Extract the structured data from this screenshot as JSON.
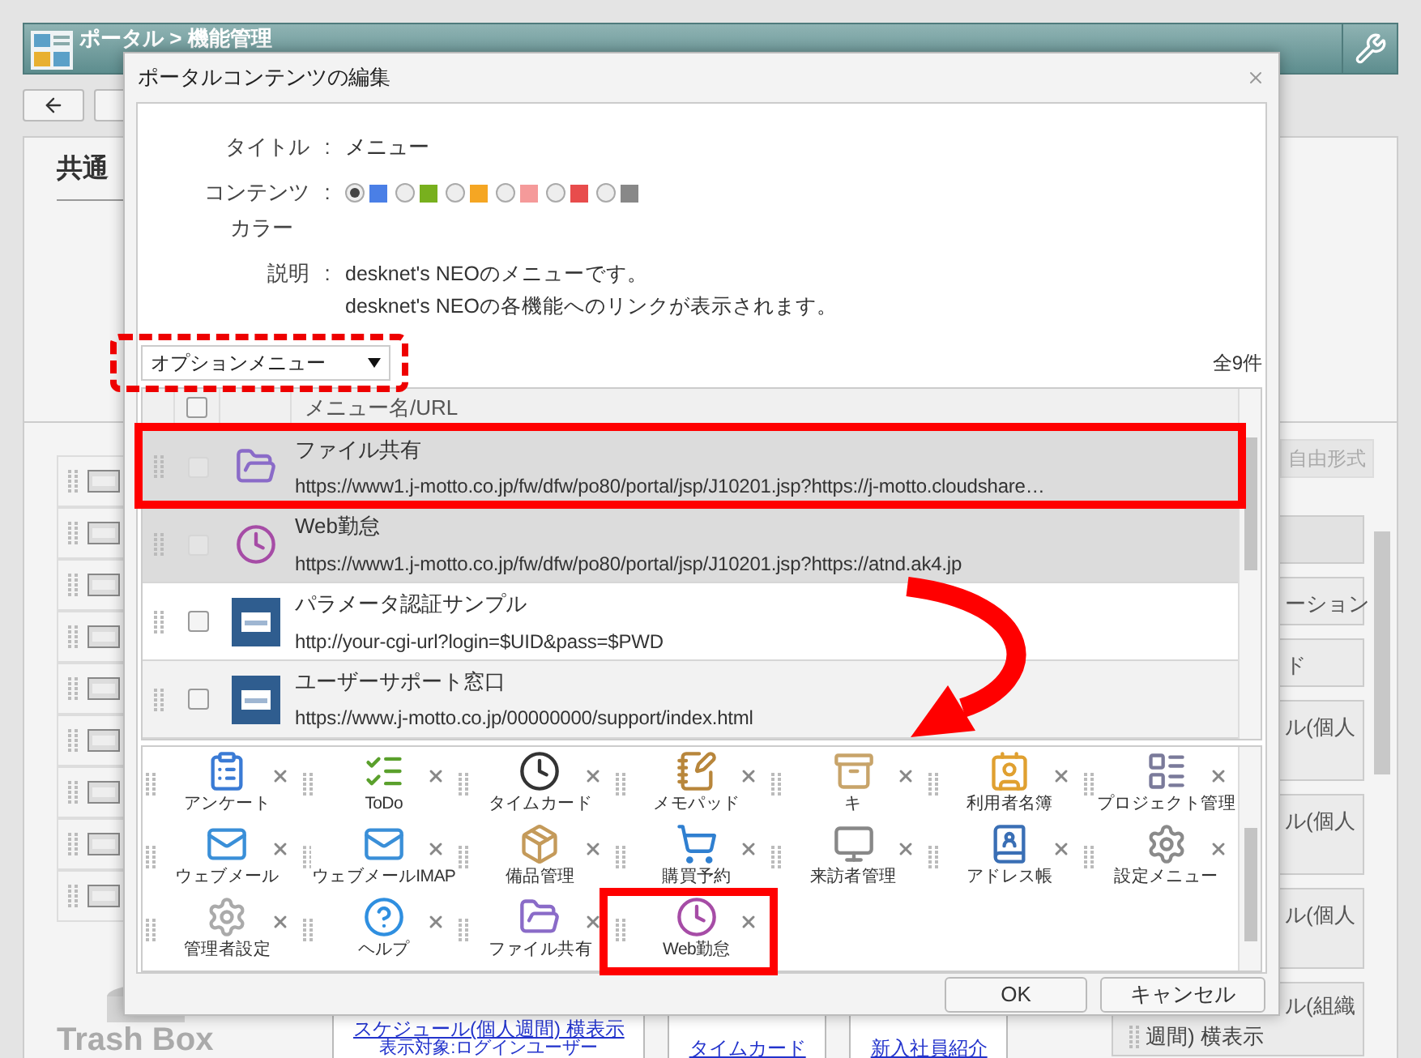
{
  "page": {
    "breadcrumb": "ポータル > 機能管理",
    "section_title": "共通",
    "tab": "自由形式",
    "right_buttons": [
      {
        "label": "ーション"
      },
      {
        "label": "ド"
      },
      {
        "label": "ル(個人"
      },
      {
        "label": "ル(個人"
      },
      {
        "label": "ル(個人"
      }
    ],
    "right_card": {
      "line_1": "ル(組織",
      "line_2": "週間) 横表示"
    },
    "trash": "Trash Box",
    "links": [
      {
        "link": "スケジュール(個人週間) 横表示",
        "target": "表示対象:ログインユーザー"
      },
      {
        "link": "タイムカード"
      },
      {
        "link": "新入社員紹介"
      }
    ]
  },
  "dialog": {
    "title": "ポータルコンテンツの編集",
    "fields": [
      {
        "kind": "text",
        "label": "タイトル",
        "colon": ":",
        "value": "メニュー"
      },
      {
        "kind": "colors",
        "label": "コンテンツ",
        "label_2": "カラー",
        "colon": ":",
        "colors": [
          {
            "color": "#4a7fe6",
            "selected": true
          },
          {
            "color": "#78b01e",
            "selected": false
          },
          {
            "color": "#f5a623",
            "selected": false
          },
          {
            "color": "#f59a9a",
            "selected": false
          },
          {
            "color": "#e84c4c",
            "selected": false
          },
          {
            "color": "#888888",
            "selected": false
          }
        ]
      },
      {
        "kind": "lines",
        "label": "説明",
        "colon": ":",
        "lines": [
          "desknet's NEOのメニューです。",
          "desknet's NEOの各機能へのリンクが表示されます。"
        ]
      }
    ],
    "filter": "オプションメニュー",
    "count": "全9件",
    "table": {
      "header": "メニュー名/URL",
      "header_checked": false,
      "rows": [
        {
          "name": "ファイル共有",
          "url": "https://www1.j-motto.co.jp/fw/dfw/po80/portal/jsp/J10201.jsp?https://j-motto.cloudshare…",
          "disabled": true,
          "checked": false
        },
        {
          "name": "Web勤怠",
          "url": "https://www1.j-motto.co.jp/fw/dfw/po80/portal/jsp/J10201.jsp?https://atnd.ak4.jp",
          "disabled": true,
          "checked": false
        },
        {
          "name": "パラメータ認証サンプル",
          "url": "http://your-cgi-url?login=$UID&pass=$PWD",
          "disabled": false,
          "checked": false
        },
        {
          "name": "ユーザーサポート窓口",
          "url": "https://www.j-motto.co.jp/00000000/support/index.html",
          "disabled": false,
          "checked": false
        }
      ]
    },
    "menu_items": [
      {
        "label": "アンケート"
      },
      {
        "label": "ToDo"
      },
      {
        "label": "タイムカード"
      },
      {
        "label": "メモパッド"
      },
      {
        "label": "キ"
      },
      {
        "label": "利用者名簿"
      },
      {
        "label": "プロジェクト管理"
      },
      {
        "label": "ウェブメール"
      },
      {
        "label": "ウェブメールIMAP"
      },
      {
        "label": "備品管理"
      },
      {
        "label": "購買予約"
      },
      {
        "label": "来訪者管理"
      },
      {
        "label": "アドレス帳"
      },
      {
        "label": "設定メニュー"
      },
      {
        "label": "管理者設定"
      },
      {
        "label": "ヘルプ"
      },
      {
        "label": "ファイル共有"
      },
      {
        "label": "Web勤怠"
      }
    ],
    "buttons": [
      "OK",
      "キャンセル"
    ]
  }
}
